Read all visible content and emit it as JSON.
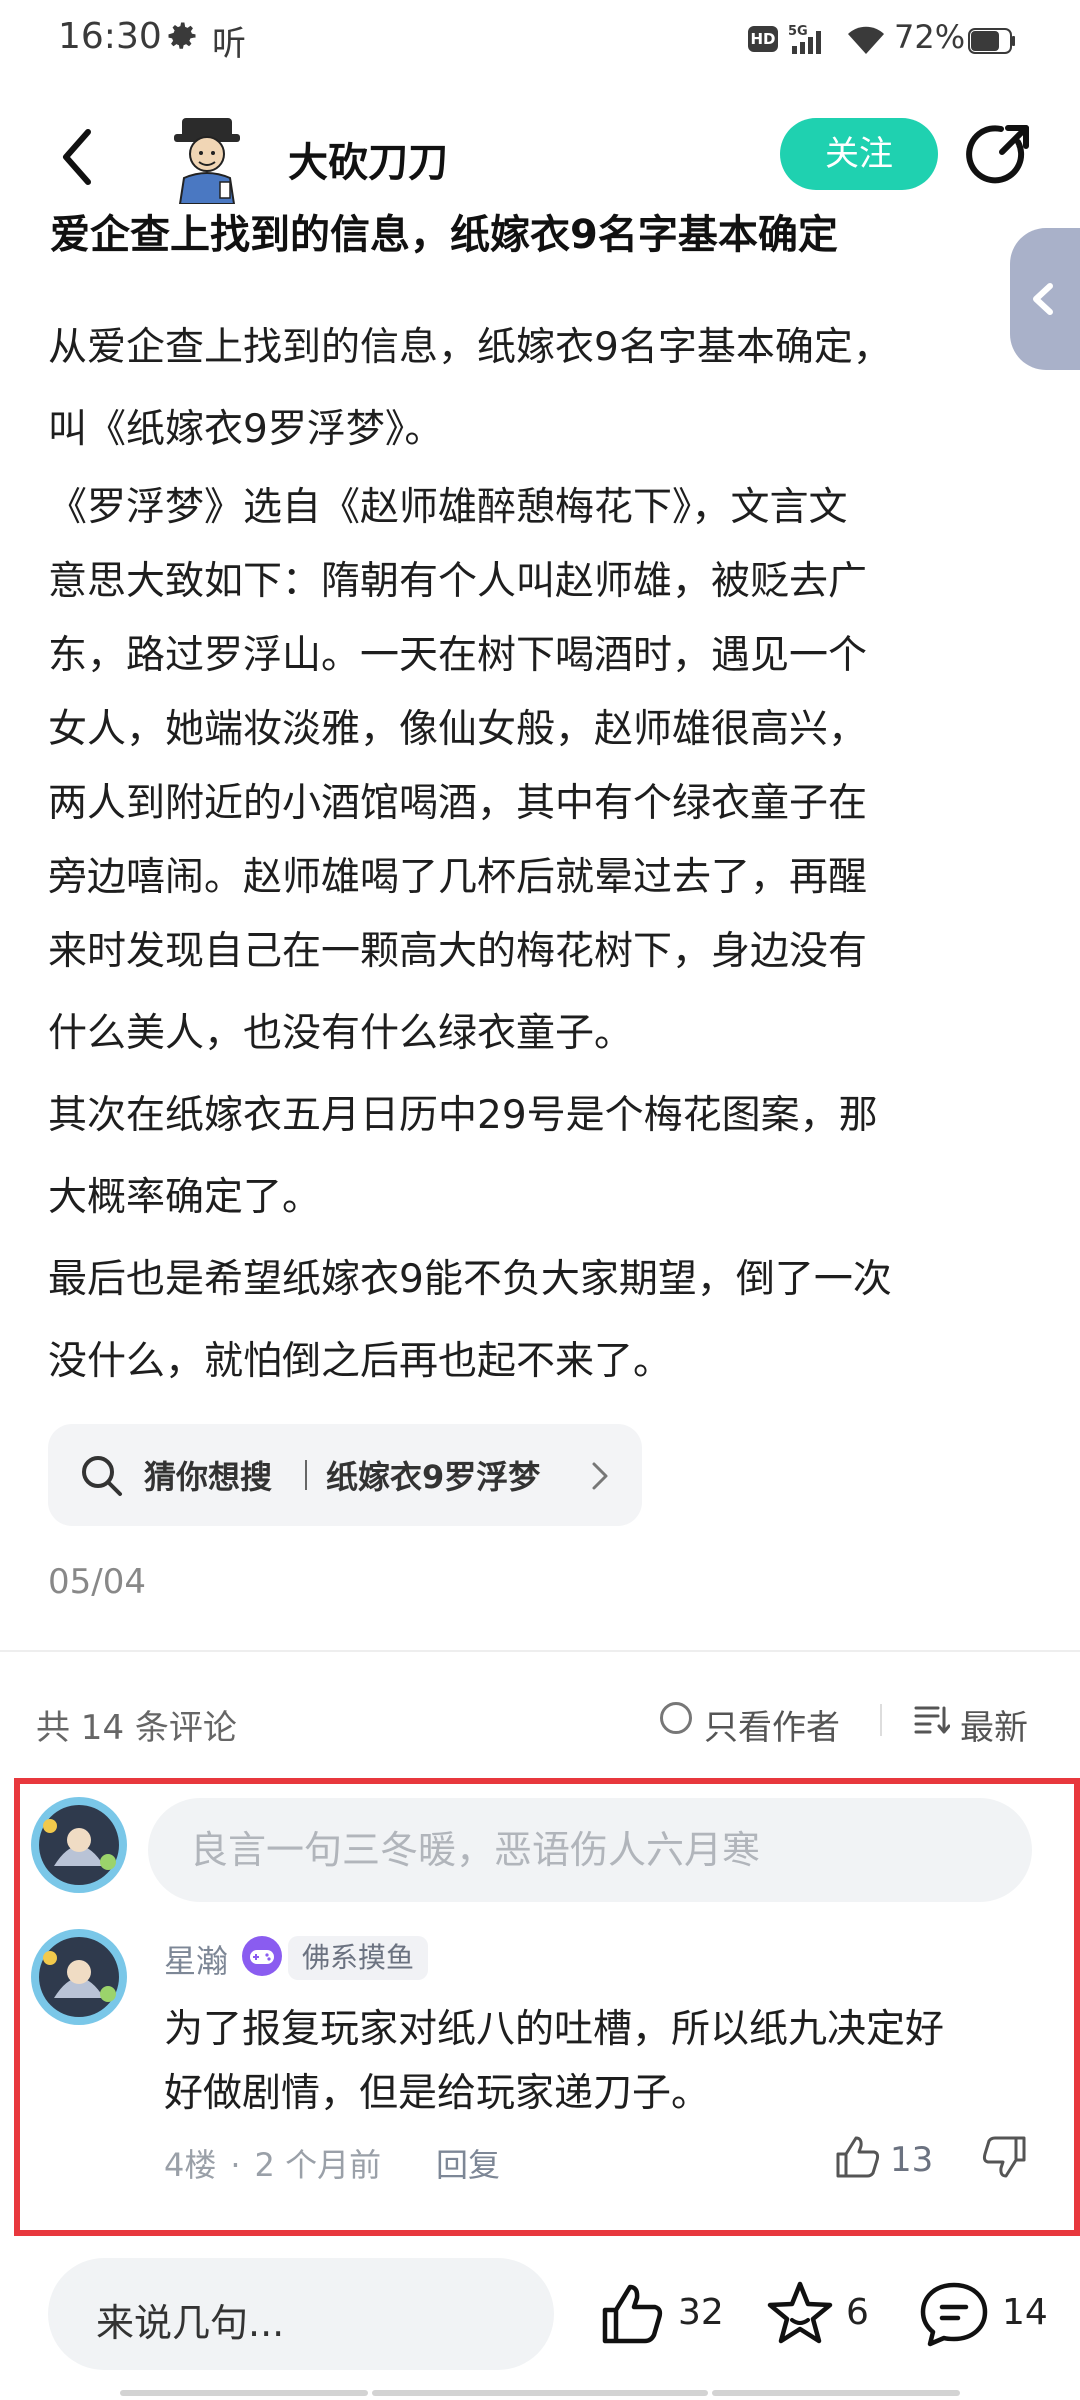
{
  "status_bar": {
    "time": "16:30",
    "listen_glyph": "听",
    "network": "5G",
    "hd": "HD",
    "battery": "72%",
    "icons": [
      "gear-icon",
      "hd-icon",
      "signal-5g-icon",
      "wifi-icon",
      "battery-icon"
    ]
  },
  "header": {
    "author_name": "大砍刀刀",
    "follow_label": "关注"
  },
  "post": {
    "title_partial": "爱企查上找到的信息，纸嫁衣9名字基本确定",
    "lines": [
      "从爱企查上找到的信息，纸嫁衣9名字基本确定，",
      "叫《纸嫁衣9罗浮梦》。",
      "《罗浮梦》选自《赵师雄醉憩梅花下》，文言文",
      "意思大致如下：隋朝有个人叫赵师雄，被贬去广",
      "东，路过罗浮山。一天在树下喝酒时，遇见一个",
      "女人，她端妆淡雅，像仙女般，赵师雄很高兴，",
      "两人到附近的小酒馆喝酒，其中有个绿衣童子在",
      "旁边嘻闹。赵师雄喝了几杯后就晕过去了，再醒",
      "来时发现自己在一颗高大的梅花树下，身边没有",
      "什么美人，也没有什么绿衣童子。",
      "其次在纸嫁衣五月日历中29号是个梅花图案，那",
      "大概率确定了。",
      "最后也是希望纸嫁衣9能不负大家期望，倒了一次",
      "没什么，就怕倒之后再也起不来了。"
    ],
    "search_suggest": {
      "prefix": "猜你想搜",
      "query": "纸嫁衣9罗浮梦"
    },
    "date": "05/04"
  },
  "comments": {
    "count_label": "共 14 条评论",
    "author_only_label": "只看作者",
    "sort_label": "最新",
    "input_placeholder": "良言一句三冬暖，恶语伤人六月寒",
    "items": [
      {
        "user": "星瀚",
        "tag": "佛系摸鱼",
        "lines": [
          "为了报复玩家对纸八的吐槽，所以纸九决定好",
          "好做剧情，但是给玩家递刀子。"
        ],
        "floor": "4楼",
        "dot": "·",
        "time": "2 个月前",
        "reply_label": "回复",
        "likes": "13"
      }
    ]
  },
  "bottom_bar": {
    "input_placeholder": "来说几句...",
    "likes": "32",
    "favorites": "6",
    "comments": "14"
  },
  "colors": {
    "accent": "#1fd1b0",
    "highlight_border": "#e8383d",
    "side_tab": "#a9b1c9"
  }
}
